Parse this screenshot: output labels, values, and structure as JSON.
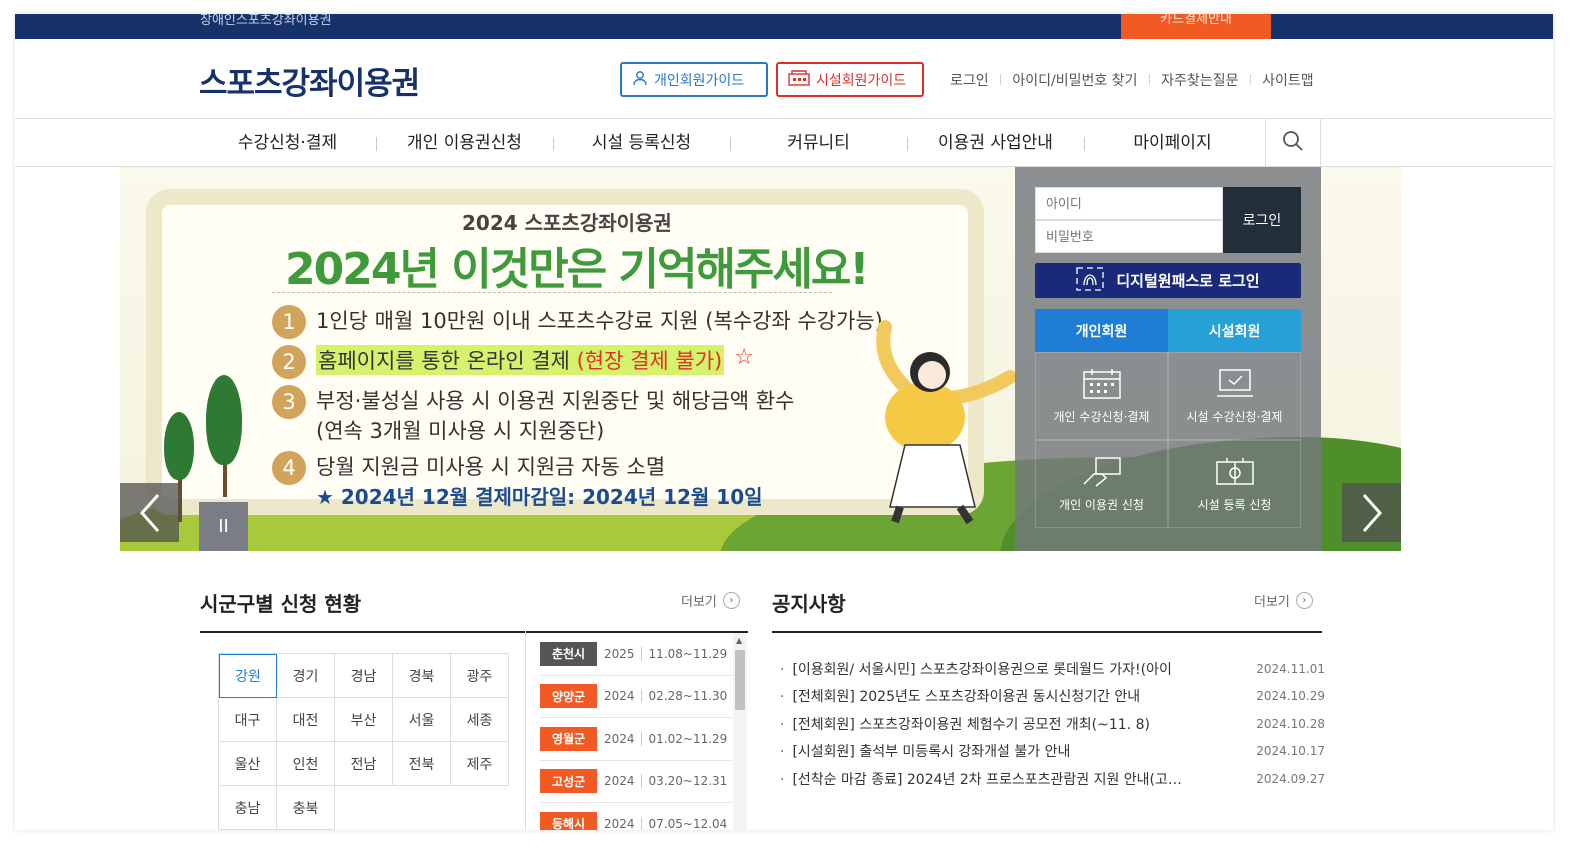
{
  "topbar": {
    "site_name": "장애인스포츠강좌이용권",
    "card_notice": "카드결제안내"
  },
  "header": {
    "logo": "스포츠강좌이용권",
    "guide_person": "개인회원가이드",
    "guide_facility": "시설회원가이드",
    "util_links": [
      "로그인",
      "아이디/비밀번호 찾기",
      "자주찾는질문",
      "사이트맵"
    ]
  },
  "nav": {
    "items": [
      "수강신청·결제",
      "개인 이용권신청",
      "시설 등록신청",
      "커뮤니티",
      "이용권 사업안내",
      "마이페이지"
    ]
  },
  "banner": {
    "subtitle": "2024 스포츠강좌이용권",
    "title": "2024년 이것만은 기억해주세요!",
    "points": [
      {
        "num": "1",
        "text": "1인당 매월 10만원 이내 스포츠수강료 지원 (복수강좌 수강가능)"
      },
      {
        "num": "2",
        "text": "홈페이지를 통한 온라인 결제",
        "highlight": "(현장 결제 불가)"
      },
      {
        "num": "3",
        "text": "부정·불성실 사용 시 이용권 지원중단 및 해당금액 환수",
        "text2": "(연속 3개월 미사용 시 지원중단)"
      },
      {
        "num": "4",
        "text": "당월 지원금 미사용 시 지원금 자동 소멸"
      }
    ],
    "deadline": "★ 2024년 12월 결제마감일: 2024년 12월 10일",
    "pause": "II"
  },
  "login": {
    "id_placeholder": "아이디",
    "pw_placeholder": "비밀번호",
    "login_button": "로그인",
    "digital_login": "디지털원패스로 로그인",
    "tab_person": "개인회원",
    "tab_facility": "시설회원",
    "quick": [
      "개인 수강신청·결제",
      "시설 수강신청·결제",
      "개인 이용권 신청",
      "시설 등록 신청"
    ]
  },
  "region_section": {
    "title": "시군구별 신청 현황",
    "more": "더보기",
    "regions": [
      "강원",
      "경기",
      "경남",
      "경북",
      "광주",
      "대구",
      "대전",
      "부산",
      "서울",
      "세종",
      "울산",
      "인천",
      "전남",
      "전북",
      "제주",
      "충남",
      "충북"
    ],
    "active_region": "강원",
    "status": [
      {
        "name": "춘천시",
        "year": "2025",
        "period": "11.08~11.29",
        "color": "dark"
      },
      {
        "name": "양양군",
        "year": "2024",
        "period": "02.28~11.30",
        "color": "orange"
      },
      {
        "name": "영월군",
        "year": "2024",
        "period": "01.02~11.29",
        "color": "orange"
      },
      {
        "name": "고성군",
        "year": "2024",
        "period": "03.20~12.31",
        "color": "orange"
      },
      {
        "name": "동해시",
        "year": "2024",
        "period": "07.05~12.04",
        "color": "orange"
      }
    ]
  },
  "notice_section": {
    "title": "공지사항",
    "more": "더보기",
    "items": [
      {
        "title": "[이용회원/ 서울시민] 스포츠강좌이용권으로 롯데월드 가자!(아이",
        "date": "2024.11.01"
      },
      {
        "title": "[전체회원] 2025년도 스포츠강좌이용권 동시신청기간 안내",
        "date": "2024.10.29"
      },
      {
        "title": "[전체회원] 스포츠강좌이용권 체험수기 공모전 개최(~11. 8)",
        "date": "2024.10.28"
      },
      {
        "title": "[시설회원] 출석부 미등록시 강좌개설 불가 안내",
        "date": "2024.10.17"
      },
      {
        "title": "[선착순 마감 종료] 2024년 2차 프로스포츠관람권 지원 안내(고…",
        "date": "2024.09.27"
      }
    ]
  },
  "colors": {
    "brand_navy": "#17326b",
    "accent_orange": "#f15a22",
    "person_blue": "#1f7dd6",
    "facility_red": "#d9302a"
  }
}
